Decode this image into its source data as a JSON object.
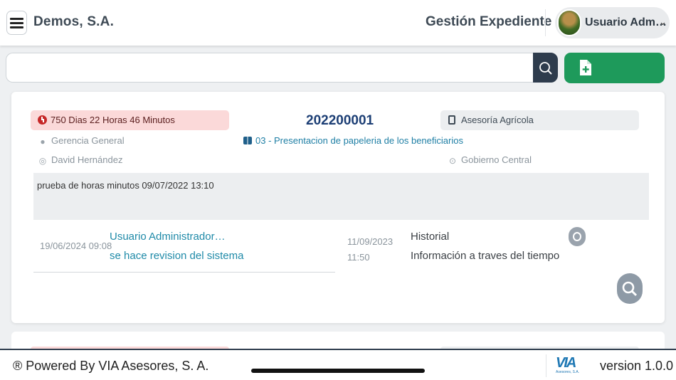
{
  "header": {
    "company": "Demos, S.A.",
    "module_title": "Gestión Expediente",
    "user_name": "Usuario Adm…",
    "chevron": "⌄"
  },
  "search": {
    "value": "",
    "placeholder": ""
  },
  "case": {
    "elapsed": "750 Dias 22 Horas 46 Minutos",
    "number": "202200001",
    "category": "Asesoría Agrícola",
    "department": "Gerencia General",
    "step": "03 - Presentacion de papeleria de los beneficiarios",
    "person": "David Hernández",
    "entity": "Gobierno Central",
    "note": "prueba de horas minutos 09/07/2022 13:10",
    "last_comment": {
      "date": "19/06/2024 09:08",
      "user": "Usuario Administrador…",
      "text": "se hace revision del sistema"
    },
    "history": {
      "date": "11/09/2023",
      "time": "11:50",
      "title": "Historial",
      "description": "Información a traves del tiempo"
    }
  },
  "footer": {
    "powered": "® Powered By VIA Asesores, S. A.",
    "logo_mark": "VIA",
    "logo_sub": "Asesores, S.A.",
    "version": "version 1.0.0"
  },
  "colors": {
    "primary": "#2e3c4d",
    "success": "#1e9a5b",
    "danger_bg": "#fbd9d9",
    "link": "#1f8aa8",
    "title_blue": "#1d3f75"
  },
  "icons": {
    "menu": "hamburger-icon",
    "search": "search-icon",
    "new_file": "file-plus-icon",
    "clock": "clock-icon",
    "book": "book-icon",
    "group": "users-icon",
    "step": "workflow-icon",
    "fingerprint": "fingerprint-icon",
    "broadcast": "broadcast-icon",
    "toggle": "eye-icon",
    "fab": "search-icon"
  }
}
